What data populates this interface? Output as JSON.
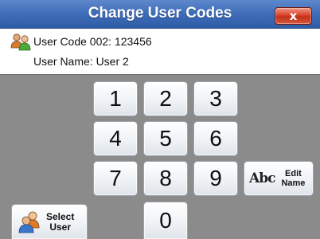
{
  "window": {
    "title": "Change User Codes",
    "close_glyph": "x"
  },
  "info": {
    "icon": "users-icon",
    "code_line": "User Code 002: 123456",
    "name_line": "User Name: User 2"
  },
  "keypad": {
    "keys": [
      "1",
      "2",
      "3",
      "4",
      "5",
      "6",
      "7",
      "8",
      "9",
      "0"
    ]
  },
  "edit_name": {
    "icon_text": "Abc",
    "label_line1": "Edit",
    "label_line2": "Name"
  },
  "select_user": {
    "icon": "user-group-icon",
    "label_line1": "Select",
    "label_line2": "User"
  },
  "colors": {
    "titlebar": "#3e6cb8",
    "close_button": "#d8442a",
    "background": "#8b8b8b"
  }
}
